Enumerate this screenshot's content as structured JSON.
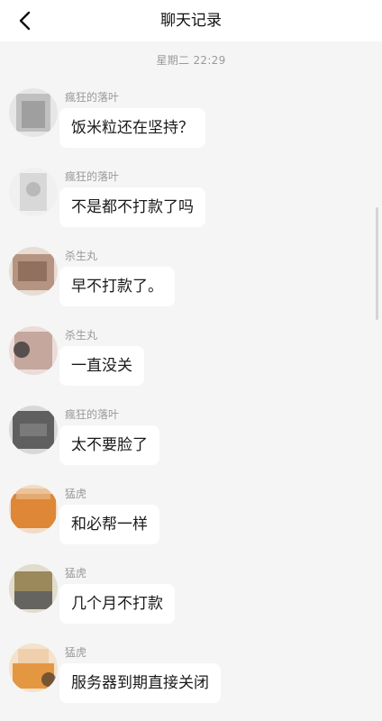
{
  "header": {
    "title": "聊天记录",
    "back_icon": "chevron-left-icon"
  },
  "time_divider": "星期二 22:29",
  "messages": [
    {
      "sender": "瘋狂的落叶",
      "text": "饭米粒还在坚持？",
      "avatar_color": "#9e9e9e"
    },
    {
      "sender": "瘋狂的落叶",
      "text": "不是都不打款了吗",
      "avatar_color": "#cfcfcf"
    },
    {
      "sender": "杀生丸",
      "text": "早不打款了。",
      "avatar_color": "#a07560"
    },
    {
      "sender": "杀生丸",
      "text": "一直没关",
      "avatar_color": "#b08a80"
    },
    {
      "sender": "瘋狂的落叶",
      "text": "太不要脸了",
      "avatar_color": "#4a4a4a"
    },
    {
      "sender": "猛虎",
      "text": "和必帮一样",
      "avatar_color": "#d9781f"
    },
    {
      "sender": "猛虎",
      "text": "几个月不打款",
      "avatar_color": "#8a7440"
    },
    {
      "sender": "猛虎",
      "text": "服务器到期直接关闭",
      "avatar_color": "#e08a28"
    }
  ]
}
